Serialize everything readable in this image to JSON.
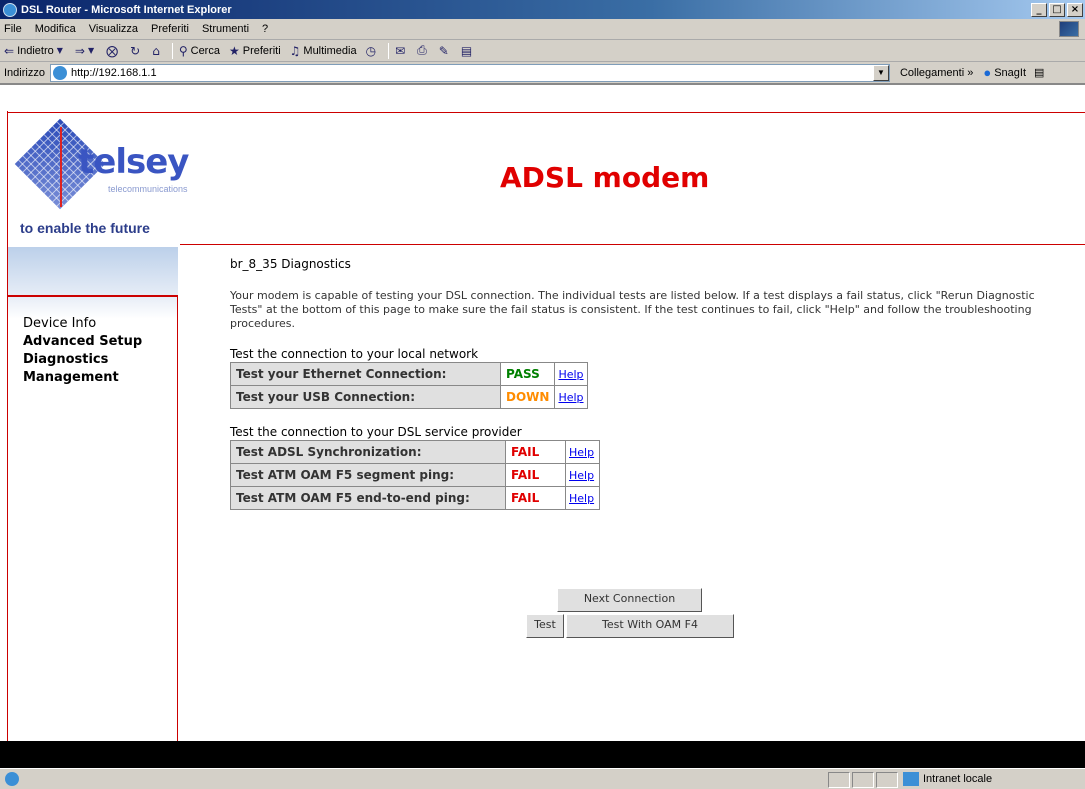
{
  "window": {
    "title": "DSL Router - Microsoft Internet Explorer",
    "controls": [
      "_",
      "□",
      "×"
    ]
  },
  "menubar": {
    "items": [
      "File",
      "Modifica",
      "Visualizza",
      "Preferiti",
      "Strumenti",
      "?"
    ]
  },
  "toolbar": {
    "back": "Indietro",
    "search": "Cerca",
    "favorites": "Preferiti",
    "multimedia": "Multimedia"
  },
  "addressbar": {
    "label": "Indirizzo",
    "url": "http://192.168.1.1",
    "links": "Collegamenti",
    "snagit": "SnagIt"
  },
  "header": {
    "logo_text": "telsey",
    "logo_sub": "telecommunications",
    "tagline": "to enable the future",
    "title": "ADSL modem"
  },
  "sidebar": {
    "items": [
      {
        "label": "Device Info"
      },
      {
        "label": "Advanced Setup"
      },
      {
        "label": "Diagnostics"
      },
      {
        "label": "Management"
      }
    ]
  },
  "main": {
    "heading": "br_8_35 Diagnostics",
    "intro": "Your modem is capable of testing your DSL connection. The individual tests are listed below. If a test displays a fail status, click \"Rerun Diagnostic Tests\" at the bottom of this page to make sure the fail status is consistent. If the test continues to fail, click \"Help\" and follow the troubleshooting procedures.",
    "local_title": "Test the connection to your local network",
    "local_tests": [
      {
        "label": "Test your Ethernet Connection:",
        "status": "PASS",
        "help": "Help"
      },
      {
        "label": "Test your USB Connection:",
        "status": "DOWN",
        "help": "Help"
      }
    ],
    "dsl_title": "Test the connection to your DSL service provider",
    "dsl_tests": [
      {
        "label": "Test ADSL Synchronization:",
        "status": "FAIL",
        "help": "Help"
      },
      {
        "label": "Test ATM OAM F5 segment ping:",
        "status": "FAIL",
        "help": "Help"
      },
      {
        "label": "Test ATM OAM F5 end-to-end ping:",
        "status": "FAIL",
        "help": "Help"
      }
    ],
    "buttons": {
      "next_connection": "Next Connection",
      "test": "Test",
      "test_oam_f4": "Test With OAM F4"
    }
  },
  "statusbar": {
    "zone": "Intranet locale"
  },
  "colors": {
    "accent_red": "#e00000",
    "pass": "#008000",
    "down": "#ff8c00",
    "fail": "#e00000"
  }
}
